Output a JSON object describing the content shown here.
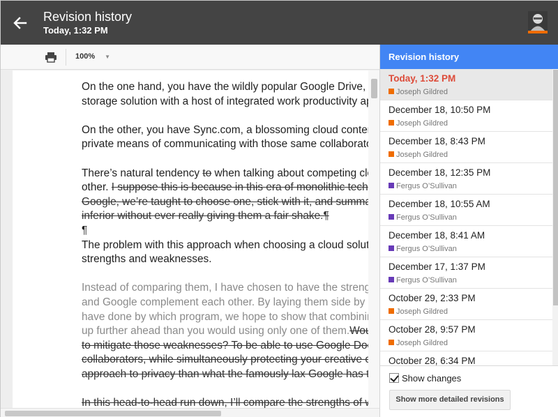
{
  "header": {
    "title": "Revision history",
    "subtitle": "Today, 1:32 PM"
  },
  "toolbar": {
    "zoom": "100%"
  },
  "document": {
    "p1": [
      "On the one hand, you have the wildly popular Google Drive, a",
      "storage solution with a host of integrated work productivity ap"
    ],
    "p2": [
      "On the other, you have Sync.com, a blossoming cloud conten",
      "private means of communicating with those same collaborato"
    ],
    "p3a_normal": "There’s natural tendency ",
    "p3a_strike": "to",
    "p3a_rest": " when talking about competing clo",
    "p3b_normal": "other. ",
    "p3b_strike": "I suppose this is because in this era of monolithic tech",
    "p3c_strike": "Google, we’re taught to choose one, stick with it, and summa",
    "p3d_strike": "inferior without ever really giving them a fair shake.¶",
    "pilcrow": "¶",
    "p4": [
      "The problem with this approach when choosing a cloud soluti",
      "strengths and weaknesses."
    ],
    "p5_grey": [
      "Instead of comparing them, I have chosen to have the strengt",
      "and Google complement each other. By laying them side by s",
      "have done by which program, we hope to show that combinin"
    ],
    "p5d_grey": "up further ahead than you would using only one of them.",
    "p5d_strike": "Wou",
    "p5e_strike": "to mitigate those weaknesses? To be able to use Google Doc",
    "p5f_strike": "collaborators, while simultaneously protecting your creative o",
    "p5g_strike": "approach to privacy than what the famously lax Google has t",
    "p6_strike": "In this head-to-head run down, I’ll compare the strengths of w"
  },
  "panel": {
    "title": "Revision history",
    "show_changes": "Show changes",
    "more_button": "Show more detailed revisions",
    "revisions": [
      {
        "date": "Today, 1:32 PM",
        "author": "Joseph Gildred",
        "color": "#ef6c00"
      },
      {
        "date": "December 18, 10:50 PM",
        "author": "Joseph Gildred",
        "color": "#ef6c00"
      },
      {
        "date": "December 18, 8:43 PM",
        "author": "Joseph Gildred",
        "color": "#ef6c00"
      },
      {
        "date": "December 18, 12:35 PM",
        "author": "Fergus O’Sullivan",
        "color": "#673ab7"
      },
      {
        "date": "December 18, 10:55 AM",
        "author": "Fergus O’Sullivan",
        "color": "#673ab7"
      },
      {
        "date": "December 18, 8:41 AM",
        "author": "Fergus O’Sullivan",
        "color": "#673ab7"
      },
      {
        "date": "December 17, 1:37 PM",
        "author": "Fergus O’Sullivan",
        "color": "#673ab7"
      },
      {
        "date": "October 29, 2:33 PM",
        "author": "Joseph Gildred",
        "color": "#ef6c00"
      },
      {
        "date": "October 28, 9:57 PM",
        "author": "Joseph Gildred",
        "color": "#ef6c00"
      },
      {
        "date": "October 28, 6:34 PM",
        "author": "",
        "color": "#ef6c00"
      }
    ]
  },
  "icons": {
    "back": "arrow-left-icon",
    "print": "printer-icon",
    "zoom_caret": "caret-down-icon"
  }
}
